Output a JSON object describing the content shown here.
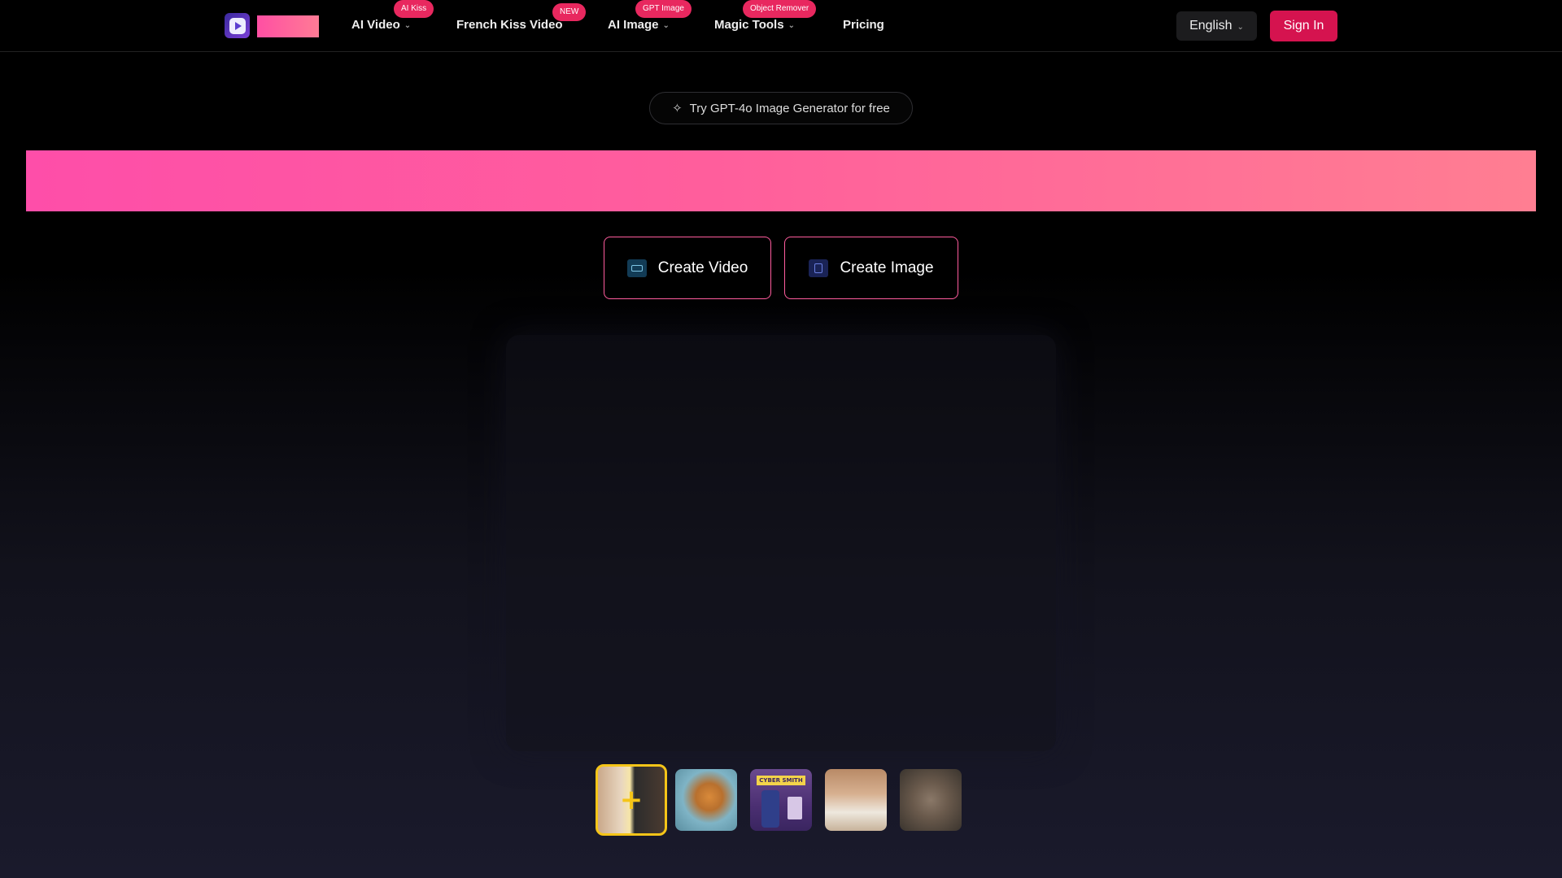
{
  "nav": {
    "items": [
      {
        "label": "AI Video",
        "badge": "AI Kiss",
        "has_dropdown": true
      },
      {
        "label": "French Kiss Video",
        "badge": "NEW",
        "has_dropdown": false
      },
      {
        "label": "AI Image",
        "badge": "GPT Image",
        "has_dropdown": true
      },
      {
        "label": "Magic Tools",
        "badge": "Object Remover",
        "has_dropdown": true
      },
      {
        "label": "Pricing",
        "badge": "",
        "has_dropdown": false
      }
    ],
    "language": "English",
    "sign_in": "Sign In"
  },
  "promo": {
    "text": "Try GPT-4o Image Generator for free",
    "icon": "sparkle-icon"
  },
  "actions": {
    "create_video": "Create Video",
    "create_image": "Create Image"
  },
  "thumbnails": {
    "count": 5,
    "selected_index": 0,
    "items": [
      {
        "icon": "couple-kiss-thumbnail"
      },
      {
        "icon": "cat-guitar-thumbnail"
      },
      {
        "icon": "action-figure-thumbnail",
        "label": "CYBER SMITH"
      },
      {
        "icon": "man-portrait-thumbnail"
      },
      {
        "icon": "cat-portrait-thumbnail"
      }
    ]
  },
  "colors": {
    "accent": "#d5134f",
    "badge": "#e8285f",
    "banner_start": "#fe4ea9",
    "banner_end": "#ff7e92",
    "selected_border": "#f5c518"
  }
}
